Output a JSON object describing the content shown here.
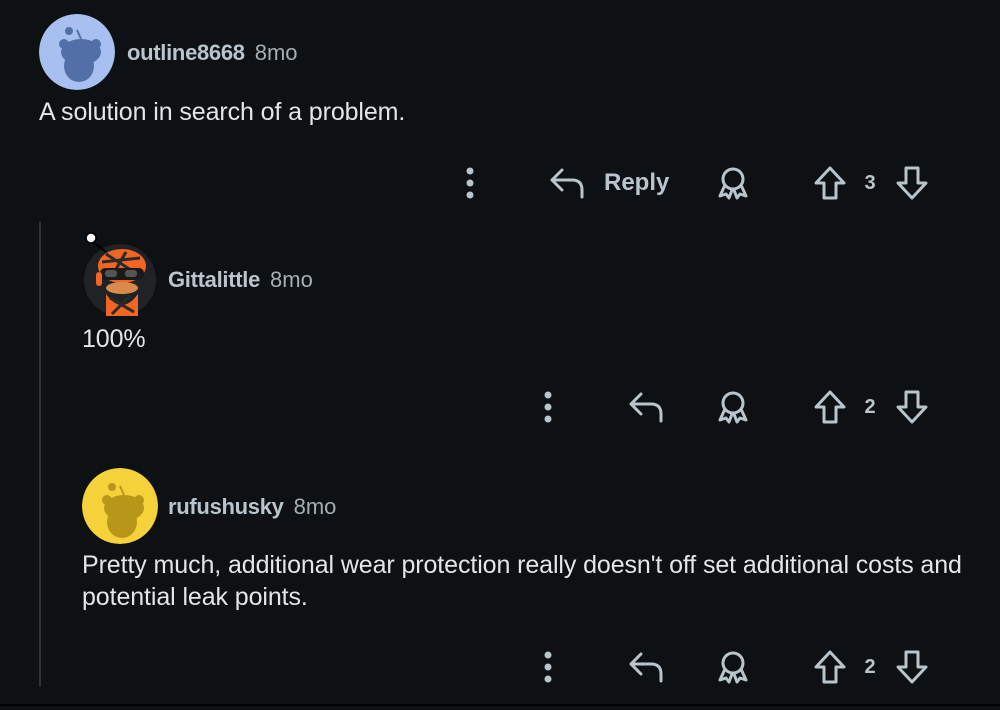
{
  "comments": [
    {
      "username": "outline8668",
      "age": "8mo",
      "text": "A solution in search of a problem.",
      "reply_label": "Reply",
      "score": "3",
      "avatar_icon": "snoo-avatar-blue",
      "avatar_color": "#a8c0f0"
    },
    {
      "username": "Gittalittle",
      "age": "8mo",
      "text": "100%",
      "score": "2",
      "avatar_icon": "snoo-avatar-orange-helmet",
      "avatar_color": "#f26522"
    },
    {
      "username": "rufushusky",
      "age": "8mo",
      "text": "Pretty much, additional wear protection really doesn't off set additional costs and potential leak points.",
      "score": "2",
      "avatar_icon": "snoo-avatar-yellow",
      "avatar_color": "#f5d23a"
    }
  ],
  "icons": {
    "more": "more-options-icon",
    "reply": "reply-arrow-icon",
    "award": "award-icon",
    "upvote": "upvote-arrow-icon",
    "downvote": "downvote-arrow-icon"
  },
  "colors": {
    "background": "#0e1113",
    "icon": "#b8c5cc",
    "text": "#e3e6e8"
  }
}
